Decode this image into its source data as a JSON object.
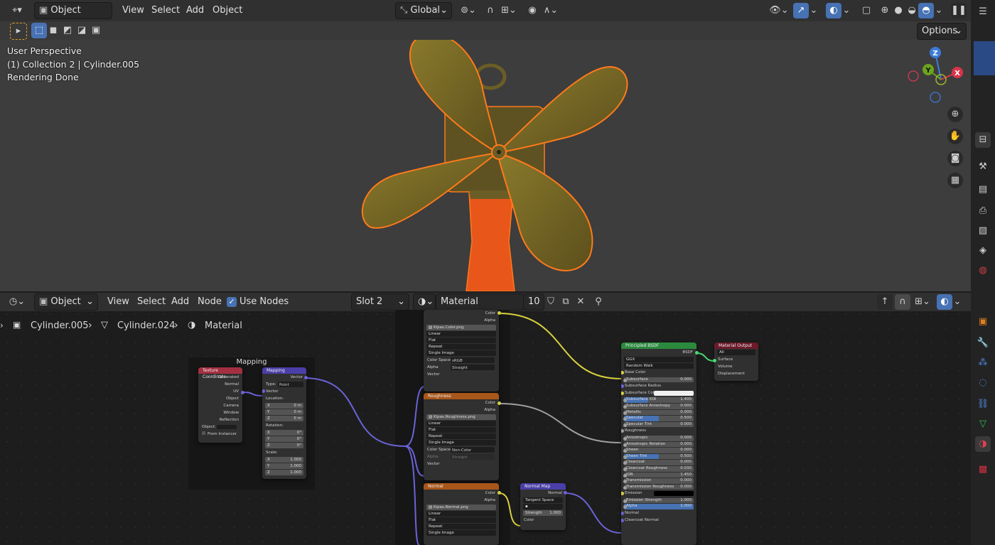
{
  "viewport": {
    "header": {
      "mode": "Object Mode",
      "menus": [
        "View",
        "Select",
        "Add",
        "Object"
      ],
      "orientation": "Global",
      "options_label": "Options"
    },
    "overlay": {
      "line1": "User Perspective",
      "line2": "(1) Collection 2 | Cylinder.005",
      "line3": "Rendering Done"
    },
    "gizmo": {
      "z": "Z",
      "y": "Y",
      "x": "X"
    }
  },
  "node_editor": {
    "header": {
      "editor_type": "Object",
      "menus": [
        "View",
        "Select",
        "Add",
        "Node"
      ],
      "use_nodes_label": "Use Nodes",
      "use_nodes_checked": true,
      "slot": "Slot 2",
      "material_name": "Material",
      "user_count": "10"
    },
    "breadcrumb": [
      "Cylinder.005",
      "Cylinder.024",
      "Material"
    ],
    "frame_mapping_label": "Mapping",
    "tex_coord": {
      "title": "Texture Coordinate",
      "outputs": [
        "Generated",
        "Normal",
        "UV",
        "Object",
        "Camera",
        "Window",
        "Reflection"
      ],
      "object_label": "Object:",
      "from_instancer": "From Instancer"
    },
    "mapping": {
      "title": "Mapping",
      "output": "Vector",
      "type_label": "Type:",
      "type_value": "Point",
      "vector": "Vector",
      "location": "Location:",
      "location_vals": [
        [
          "X",
          "0 m"
        ],
        [
          "Y",
          "0 m"
        ],
        [
          "Z",
          "0 m"
        ]
      ],
      "rotation": "Rotation:",
      "rotation_vals": [
        [
          "X",
          "0°"
        ],
        [
          "Y",
          "0°"
        ],
        [
          "Z",
          "0°"
        ]
      ],
      "scale": "Scale:",
      "scale_vals": [
        [
          "X",
          "1.000"
        ],
        [
          "Y",
          "1.000"
        ],
        [
          "Z",
          "1.000"
        ]
      ]
    },
    "image_color": {
      "outputs": [
        "Color",
        "Alpha"
      ],
      "file": "Kipas.Color.png",
      "fields": [
        "Linear",
        "Flat",
        "Repeat",
        "Single Image"
      ],
      "color_space_label": "Color Space",
      "color_space": "sRGB",
      "alpha_label": "Alpha",
      "alpha_value": "Straight",
      "vector": "Vector"
    },
    "image_rough": {
      "title": "Roughness",
      "outputs": [
        "Color",
        "Alpha"
      ],
      "file": "Kipas.Roughness.png",
      "fields": [
        "Linear",
        "Flat",
        "Repeat",
        "Single Image"
      ],
      "color_space_label": "Color Space",
      "color_space": "Non-Color",
      "alpha_label": "Alpha",
      "alpha_value": "Straight",
      "vector": "Vector"
    },
    "image_normal": {
      "title": "Normal",
      "outputs": [
        "Color",
        "Alpha"
      ],
      "file": "Kipas.Normal.png",
      "fields": [
        "Linear",
        "Flat",
        "Repeat",
        "Single Image"
      ]
    },
    "normal_map": {
      "title": "Normal Map",
      "output": "Normal",
      "space": "Tangent Space",
      "strength_label": "Strength",
      "strength_value": "1.000",
      "input": "Color"
    },
    "bsdf": {
      "title": "Principled BSDF",
      "output": "BSDF",
      "distribution": "GGX",
      "subsurface_method": "Random Walk",
      "inputs": [
        [
          "Base Color",
          ""
        ],
        [
          "Subsurface",
          "0.000"
        ],
        [
          "Subsurface Radius",
          ""
        ],
        [
          "Subsurface Color",
          ""
        ],
        [
          "Subsurface IOR",
          "1.400"
        ],
        [
          "Subsurface Anisotropy",
          "0.000"
        ],
        [
          "Metallic",
          "0.000"
        ],
        [
          "Specular",
          "0.500"
        ],
        [
          "Specular Tint",
          "0.000"
        ],
        [
          "Roughness",
          ""
        ],
        [
          "Anisotropic",
          "0.000"
        ],
        [
          "Anisotropic Rotation",
          "0.000"
        ],
        [
          "Sheen",
          "0.000"
        ],
        [
          "Sheen Tint",
          "0.500"
        ],
        [
          "Clearcoat",
          "0.000"
        ],
        [
          "Clearcoat Roughness",
          "0.030"
        ],
        [
          "IOR",
          "1.450"
        ],
        [
          "Transmission",
          "0.000"
        ],
        [
          "Transmission Roughness",
          "0.000"
        ],
        [
          "Emission",
          ""
        ],
        [
          "Emission Strength",
          "1.000"
        ],
        [
          "Alpha",
          "1.000"
        ],
        [
          "Normal",
          ""
        ],
        [
          "Clearcoat Normal",
          ""
        ]
      ]
    },
    "output": {
      "title": "Material Output",
      "target": "All",
      "inputs": [
        "Surface",
        "Volume",
        "Displacement"
      ]
    }
  },
  "colors": {
    "selection_orange": "#ff7a1a",
    "accent_blue": "#4772b3",
    "shader_green": "#2b8a3e",
    "image_orange": "#a8561a",
    "vector_purple": "#4a3fa8",
    "input_red": "#a33040",
    "output_red": "#6b1a2a"
  }
}
